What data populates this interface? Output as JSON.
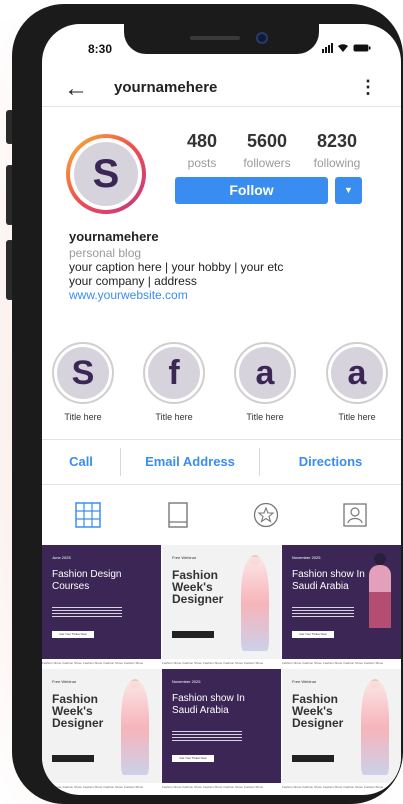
{
  "status_bar": {
    "time": "8:30",
    "signal_icon": "signal-icon",
    "wifi_icon": "wifi-icon",
    "battery_icon": "battery-icon"
  },
  "header": {
    "back_icon": "←",
    "username": "yournamehere",
    "menu_icon": "⋮"
  },
  "profile": {
    "avatar_letter": "S",
    "stats": [
      {
        "value": "480",
        "label": "posts"
      },
      {
        "value": "5600",
        "label": "followers"
      },
      {
        "value": "8230",
        "label": "following"
      }
    ],
    "follow_label": "Follow",
    "dropdown_icon": "▼"
  },
  "bio": {
    "name": "yournamehere",
    "category": "personal blog",
    "line1": "your caption here  | your hobby | your etc",
    "line2": "your company | address",
    "website": "www.yourwebsite.com"
  },
  "highlights": [
    {
      "letter": "S",
      "title": "Title here"
    },
    {
      "letter": "f",
      "title": "Title here"
    },
    {
      "letter": "a",
      "title": "Title here"
    },
    {
      "letter": "a",
      "title": "Title here"
    }
  ],
  "actions": {
    "call": "Call",
    "email": "Email Address",
    "directions": "Directions"
  },
  "tabs": [
    "grid-icon",
    "tv-icon",
    "star-icon",
    "tagged-icon"
  ],
  "posts": [
    {
      "tag": "June 2025",
      "title": "Fashion Design Courses",
      "button": "Get Your Ticket Now",
      "strip": "Fashion Show, Fashion Show, Fashion Show, Fashion Show, Fashion Show"
    },
    {
      "tag": "Free Webinar",
      "title": "Fashion Week's Designer",
      "button": "",
      "strip": "Fashion Show, Fashion Show, Fashion Show, Fashion Show, Fashion Show"
    },
    {
      "tag": "November 2025",
      "title": "Fashion show In Saudi Arabia",
      "button": "Get Your Ticket Now",
      "strip": "Fashion Show, Fashion Show, Fashion Show, Fashion Show, Fashion Show"
    },
    {
      "tag": "Free Webinar",
      "title": "Fashion Week's Designer",
      "button": "",
      "strip": "Fashion Show, Fashion Show, Fashion Show, Fashion Show, Fashion Show"
    },
    {
      "tag": "November 2025",
      "title": "Fashion show In Saudi Arabia",
      "button": "Get Your Ticket Now",
      "strip": "Fashion Show, Fashion Show, Fashion Show, Fashion Show, Fashion Show"
    },
    {
      "tag": "Free Webinar",
      "title": "Fashion Week's Designer",
      "button": "",
      "strip": "Fashion Show, Fashion Show, Fashion Show, Fashion Show, Fashion Show"
    }
  ],
  "colors": {
    "accent": "#3a8df0",
    "brand_purple": "#3b2655",
    "avatar_bg": "#d6d3dc"
  }
}
